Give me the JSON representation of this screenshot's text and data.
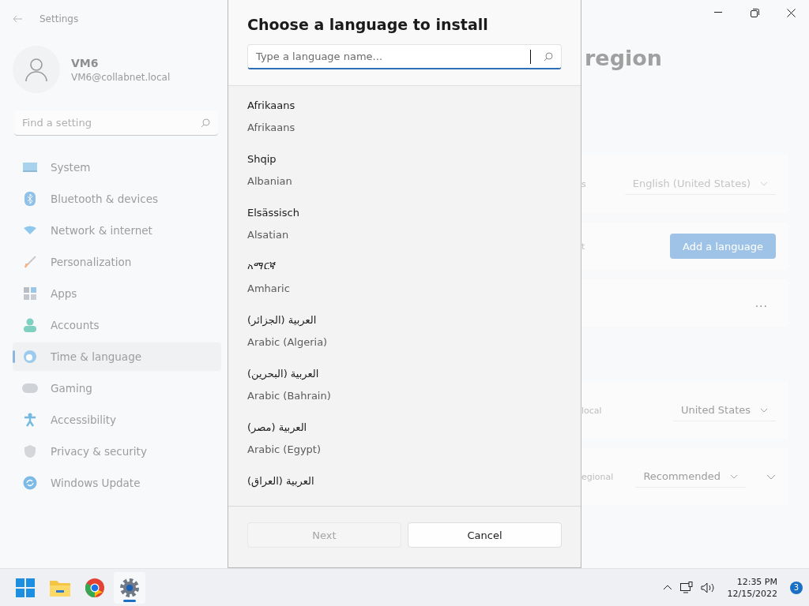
{
  "window": {
    "title": "Settings"
  },
  "user": {
    "name": "VM6",
    "email": "VM6@collabnet.local"
  },
  "search": {
    "placeholder": "Find a setting"
  },
  "nav": [
    {
      "label": "System",
      "selected": false
    },
    {
      "label": "Bluetooth & devices",
      "selected": false
    },
    {
      "label": "Network & internet",
      "selected": false
    },
    {
      "label": "Personalization",
      "selected": false
    },
    {
      "label": "Apps",
      "selected": false
    },
    {
      "label": "Accounts",
      "selected": false
    },
    {
      "label": "Time & language",
      "selected": true
    },
    {
      "label": "Gaming",
      "selected": false
    },
    {
      "label": "Accessibility",
      "selected": false
    },
    {
      "label": "Privacy & security",
      "selected": false
    },
    {
      "label": "Windows Update",
      "selected": false
    }
  ],
  "dialog": {
    "title": "Choose a language to install",
    "search_placeholder": "Type a language name...",
    "languages": [
      {
        "native": "Afrikaans",
        "english": "Afrikaans"
      },
      {
        "native": "Shqip",
        "english": "Albanian"
      },
      {
        "native": "Elsässisch",
        "english": "Alsatian"
      },
      {
        "native": "አማርኛ",
        "english": "Amharic"
      },
      {
        "native": "العربية (الجزائر)",
        "english": "Arabic (Algeria)"
      },
      {
        "native": "العربية (البحرين)",
        "english": "Arabic (Bahrain)"
      },
      {
        "native": "العربية (مصر)",
        "english": "Arabic (Egypt)"
      },
      {
        "native": "العربية (العراق)"
      }
    ],
    "buttons": [
      {
        "label": "Next",
        "disabled": true
      },
      {
        "label": "Cancel",
        "disabled": false
      }
    ]
  },
  "page": {
    "title_fragment": "region",
    "cards": [
      {
        "kind": "dropdown",
        "label": "s",
        "value": "English (United States)",
        "disabled": true
      },
      {
        "kind": "button",
        "label": "t",
        "value": "Add a language"
      },
      {
        "kind": "more",
        "value": "..."
      },
      {
        "kind": "dropdown",
        "label": "local",
        "value": "United States",
        "disabled": false
      },
      {
        "kind": "dropdown-expand",
        "label": "egional",
        "value": "Recommended",
        "disabled": false
      }
    ]
  },
  "taskbar": {
    "apps": [
      {
        "selected": false
      },
      {
        "selected": false
      },
      {
        "selected": false
      },
      {
        "selected": true
      }
    ],
    "time": "12:35 PM",
    "date": "12/15/2022",
    "badge": "3"
  }
}
